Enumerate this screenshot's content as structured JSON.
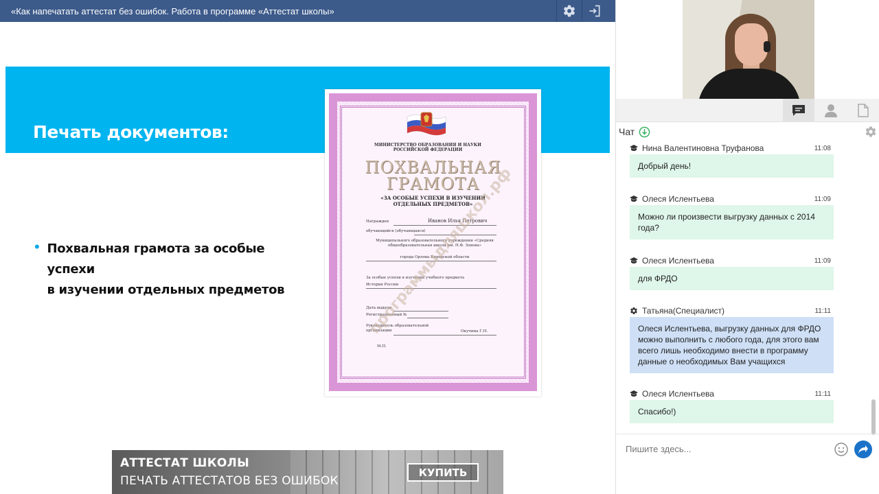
{
  "window": {
    "title": "«Как напечатать аттестат без ошибок. Работа в программе «Аттестат школы»"
  },
  "slide": {
    "heading": "Печать документов:",
    "bullet_line1": "Похвальная грамота за особые успехи",
    "bullet_line2": "в изучении отдельных предметов",
    "certificate": {
      "ministry": "МИНИСТЕРСТВО ОБРАЗОВАНИЯ И НАУКИ РОССИЙСКОЙ ФЕДЕРАЦИИ",
      "title_line1": "ПОХВАЛЬНАЯ",
      "title_line2": "ГРАМОТА",
      "subtitle": "«ЗА ОСОБЫЕ УСПЕХИ В ИЗУЧЕНИИ ОТДЕЛЬНЫХ ПРЕДМЕТОВ»",
      "awarded_label": "Награжден",
      "awarded_name": "Иванов Илья Петрович",
      "student_label": "обучающийся (обучающаяся)",
      "school": "Муниципального образовательного учреждения «Средняя общеобразовательная школа им. Н.Ф. Зонова»",
      "city": "города Орлова Кировской области",
      "subject_label": "За особые успехи в изучении учебного предмета",
      "subject": "История России",
      "date_label": "Дата выдачи",
      "reg_label": "Регистрационный №",
      "head_label": "Руководитель образовательной организации",
      "head_name": "Окучина Г.Н.",
      "mp": "М.П.",
      "watermark": "программыдляшкол.рф"
    }
  },
  "ad": {
    "title": "АТТЕСТАТ ШКОЛЫ",
    "subtitle": "ПЕЧАТЬ АТТЕСТАТОВ БЕЗ ОШИБОК",
    "button": "КУПИТЬ"
  },
  "chat": {
    "header": "Чат",
    "messages": [
      {
        "author": "Нина Валентиновна Труфанова",
        "time": "11:08",
        "text": "Добрый день!",
        "role": "student"
      },
      {
        "author": "Олеся Ислентьева",
        "time": "11:09",
        "text": "Можно ли произвести выгрузку данных с 2014 года?",
        "role": "student"
      },
      {
        "author": "Олеся Ислентьева",
        "time": "11:09",
        "text": "для ФРДО",
        "role": "student"
      },
      {
        "author": "Татьяна(Специалист)",
        "time": "11:11",
        "text": "Олеся Ислентьева, выгрузку данных для ФРДО можно выполнить с любого года, для этого вам всего лишь необходимо внести в программу данные о необходимых Вам учащихся",
        "role": "specialist"
      },
      {
        "author": "Олеся Ислентьева",
        "time": "11:11",
        "text": "Спасибо!)",
        "role": "student"
      }
    ],
    "input_placeholder": "Пишите здесь..."
  },
  "colors": {
    "topbar": "#3c5a8a",
    "slide_band": "#00b4ef",
    "student_bubble": "#dff6ea",
    "specialist_bubble": "#cfe0f6",
    "send_button": "#1a73c8"
  },
  "icons": {
    "topbar": [
      "gear-icon",
      "exit-icon"
    ],
    "tabs": [
      "chat-icon",
      "user-icon",
      "document-icon"
    ],
    "chat": [
      "refresh-icon",
      "settings-icon",
      "graduation-cap-icon",
      "gear-icon",
      "smile-icon",
      "send-icon"
    ]
  }
}
